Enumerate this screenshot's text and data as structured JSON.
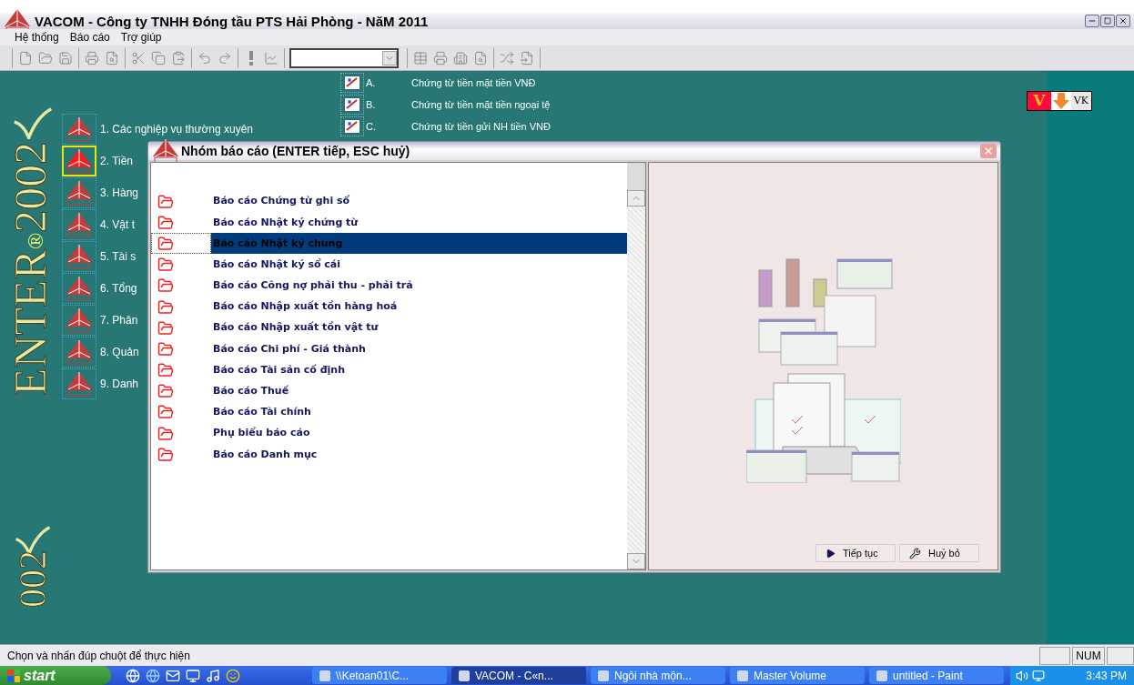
{
  "window": {
    "title": "VACOM - Công ty TNHH Đóng tầu PTS Hải Phòng - NăM 2011"
  },
  "menu": [
    "Hệ thống",
    "Báo cáo",
    "Trợ giúp"
  ],
  "logo": {
    "main": "ENTER",
    "mark": "®",
    "year": "2002",
    "bottom_year": "002"
  },
  "modules": [
    {
      "label": "1. Các nghiệp vụ thường xuyên",
      "selected": false
    },
    {
      "label": "2. Tiền",
      "selected": true
    },
    {
      "label": "3. Hàng",
      "selected": false
    },
    {
      "label": "4. Vật t",
      "selected": false
    },
    {
      "label": "5. Tài s",
      "selected": false
    },
    {
      "label": "6. Tổng",
      "selected": false
    },
    {
      "label": "7. Phân",
      "selected": false
    },
    {
      "label": "8. Quản",
      "selected": false
    },
    {
      "label": "9. Danh",
      "selected": false
    }
  ],
  "sub_items": [
    {
      "letter": "A.",
      "label": "Chứng từ tiền mặt tiền VNĐ"
    },
    {
      "letter": "B.",
      "label": "Chứng từ tiền mặt tiền ngoại tệ"
    },
    {
      "letter": "C.",
      "label": "Chứng từ tiền gửi NH tiền VNĐ"
    }
  ],
  "input_switcher": {
    "logo": "V",
    "label": "VK"
  },
  "dialog": {
    "title": "Nhóm báo cáo (ENTER tiếp, ESC huỷ)",
    "items": [
      {
        "label": "Báo cáo Chứng  từ ghi sổ",
        "selected": false
      },
      {
        "label": "Báo cáo Nhật ký chứng từ",
        "selected": false
      },
      {
        "label": "Báo cáo Nhật ký chung",
        "selected": true
      },
      {
        "label": "Báo cáo Nhật ký sổ cái",
        "selected": false
      },
      {
        "label": "Báo cáo Công nợ phải thu - phải trả",
        "selected": false
      },
      {
        "label": "Báo cáo Nhập xuất tồn hàng hoá",
        "selected": false
      },
      {
        "label": "Báo cáo Nhập xuất tồn vật tư",
        "selected": false
      },
      {
        "label": "Báo cáo Chi phí - Giá thành",
        "selected": false
      },
      {
        "label": "Báo cáo Tài sản cố định",
        "selected": false
      },
      {
        "label": "Báo cáo Thuế",
        "selected": false
      },
      {
        "label": "Báo cáo Tài chính",
        "selected": false
      },
      {
        "label": "Phụ biểu báo cáo",
        "selected": false
      },
      {
        "label": "Báo cáo Danh mục",
        "selected": false
      }
    ],
    "buttons": [
      {
        "kind": "continue",
        "label": "Tiếp tục"
      },
      {
        "kind": "cancel",
        "label": "Huỷ bỏ"
      }
    ]
  },
  "status_bar": {
    "message": "Chọn và nhấn đúp chuột để thực hiện",
    "indicator": "NUM"
  },
  "taskbar": {
    "start": "start",
    "tasks": [
      {
        "label": "\\\\Ketoan01\\C...",
        "selected": false
      },
      {
        "label": "VACOM - C«n...",
        "selected": true
      },
      {
        "label": "Ngôi nhà mộn...",
        "selected": false
      },
      {
        "label": "Master Volume",
        "selected": false
      },
      {
        "label": "untitled - Paint",
        "selected": false
      }
    ],
    "clock": "3:43 PM"
  }
}
